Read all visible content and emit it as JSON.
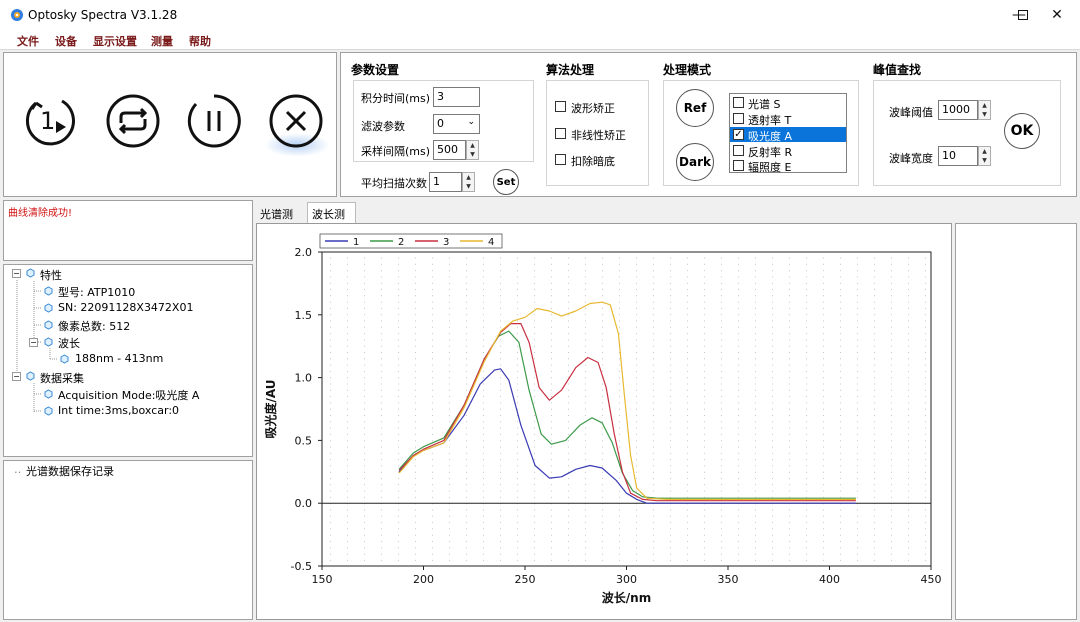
{
  "window": {
    "title": "Optosky Spectra V3.1.28"
  },
  "menu": [
    "文件",
    "设备",
    "显示设置",
    "测量",
    "帮助"
  ],
  "params": {
    "title": "参数设置",
    "integration_label": "积分时间(ms)",
    "integration_value": "3",
    "filter_label": "滤波参数",
    "filter_value": "0",
    "sampling_label": "采样间隔(ms)",
    "sampling_value": "500",
    "avg_label": "平均扫描次数",
    "avg_value": "1",
    "set_label": "Set"
  },
  "algo": {
    "title": "算法处理",
    "items": [
      {
        "label": "波形矫正",
        "checked": ""
      },
      {
        "label": "非线性矫正",
        "checked": ""
      },
      {
        "label": "扣除暗底",
        "checked": ""
      }
    ]
  },
  "mode": {
    "title": "处理模式",
    "ref_label": "Ref",
    "dark_label": "Dark",
    "items": [
      {
        "label": "光谱 S",
        "checked": ""
      },
      {
        "label": "透射率 T",
        "checked": ""
      },
      {
        "label": "吸光度 A",
        "checked": "✓"
      },
      {
        "label": "反射率 R",
        "checked": ""
      },
      {
        "label": "辐照度 E",
        "checked": ""
      }
    ]
  },
  "peak": {
    "title": "峰值查找",
    "threshold_label": "波峰阈值",
    "threshold_value": "1000",
    "width_label": "波峰宽度",
    "width_value": "10",
    "ok_label": "OK"
  },
  "message": "曲线清除成功!",
  "tree": {
    "root1": "特性",
    "model": "型号: ATP1010",
    "sn": "SN: 22091128X3472X01",
    "pixels": "像素总数: 512",
    "wave": "波长",
    "wave_range": "188nm - 413nm",
    "root2": "数据采集",
    "acq": "Acquisition Mode:吸光度 A",
    "int": "Int time:3ms,boxcar:0"
  },
  "save_record": "光谱数据保存记录",
  "tabs": [
    "光谱测量",
    "波长测量"
  ],
  "colors": {
    "s1": "#3a3ab5",
    "s2": "#3c9a4a",
    "s3": "#c83040",
    "s4": "#e8b830",
    "accent": "#1c6fd1"
  },
  "chart_data": {
    "type": "line",
    "xlabel": "波长/nm",
    "ylabel": "吸光度/AU",
    "xlim": [
      150,
      450
    ],
    "ylim": [
      -0.5,
      2.0
    ],
    "xticks": [
      150,
      200,
      250,
      300,
      350,
      400,
      450
    ],
    "yticks": [
      -0.5,
      0.0,
      0.5,
      1.0,
      1.5,
      2.0
    ],
    "xtick_labels": [
      "150",
      "200",
      "250",
      "300",
      "350",
      "400",
      "450"
    ],
    "ytick_labels": [
      "-0.5",
      "0.0",
      "0.5",
      "1.0",
      "1.5",
      "2.0"
    ],
    "legend_position": "top-left",
    "grid": "dotted",
    "series": [
      {
        "name": "1",
        "color": "#3a3ab5",
        "x": [
          188,
          195,
          200,
          210,
          220,
          228,
          235,
          238,
          242,
          248,
          255,
          262,
          268,
          275,
          282,
          288,
          295,
          300,
          305,
          310,
          320,
          413
        ],
        "y": [
          0.25,
          0.38,
          0.42,
          0.48,
          0.7,
          0.95,
          1.06,
          1.07,
          0.98,
          0.62,
          0.3,
          0.2,
          0.21,
          0.27,
          0.3,
          0.28,
          0.18,
          0.08,
          0.03,
          0.0,
          0.0,
          0.0
        ]
      },
      {
        "name": "2",
        "color": "#3c9a4a",
        "x": [
          188,
          195,
          200,
          210,
          220,
          230,
          237,
          242,
          247,
          252,
          258,
          263,
          270,
          277,
          283,
          288,
          293,
          298,
          303,
          308,
          315,
          413
        ],
        "y": [
          0.27,
          0.4,
          0.45,
          0.52,
          0.78,
          1.15,
          1.33,
          1.37,
          1.28,
          0.9,
          0.55,
          0.47,
          0.5,
          0.62,
          0.68,
          0.64,
          0.48,
          0.24,
          0.1,
          0.05,
          0.04,
          0.04
        ]
      },
      {
        "name": "3",
        "color": "#c83040",
        "x": [
          188,
          195,
          200,
          210,
          220,
          230,
          238,
          243,
          248,
          252,
          257,
          262,
          268,
          275,
          281,
          286,
          290,
          294,
          298,
          302,
          308,
          315,
          413
        ],
        "y": [
          0.26,
          0.38,
          0.43,
          0.5,
          0.78,
          1.15,
          1.36,
          1.43,
          1.43,
          1.28,
          0.92,
          0.82,
          0.9,
          1.08,
          1.16,
          1.12,
          0.92,
          0.55,
          0.25,
          0.08,
          0.03,
          0.02,
          0.02
        ]
      },
      {
        "name": "4",
        "color": "#e8b830",
        "x": [
          188,
          195,
          200,
          210,
          220,
          230,
          238,
          244,
          250,
          256,
          262,
          268,
          275,
          282,
          288,
          292,
          296,
          299,
          302,
          305,
          310,
          320,
          413
        ],
        "y": [
          0.24,
          0.37,
          0.42,
          0.48,
          0.76,
          1.13,
          1.37,
          1.45,
          1.48,
          1.55,
          1.53,
          1.49,
          1.53,
          1.59,
          1.6,
          1.58,
          1.35,
          0.85,
          0.38,
          0.12,
          0.04,
          0.03,
          0.03
        ]
      }
    ]
  }
}
